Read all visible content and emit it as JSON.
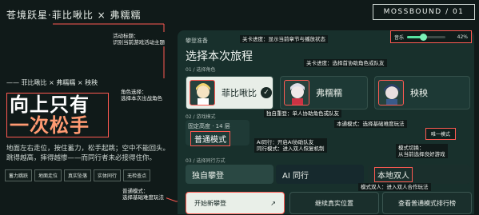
{
  "header": {
    "title": "苍境跃星·菲比啾比 × 弗糯糯",
    "brand": "MOSSBOUND / 01"
  },
  "left": {
    "divider": "—— 菲比啾比 × 弗糯糯 × 秧秧",
    "slogan_line1": "向上只有",
    "slogan_line2": "一次松手",
    "description": "地面左右走位，按住蓄力，松手起跳；空中不能回头。跳得越高，摔得越惨——而同行者未必接得住你。",
    "chips": [
      "蓄力跳跃",
      "地面走位",
      "真实坠落",
      "实体同行",
      "无检查点"
    ]
  },
  "music": {
    "label": "音乐",
    "value": "42%",
    "level": 0.42
  },
  "panel": {
    "kicker": "攀登准备",
    "title": "选择本次旅程",
    "section_character": "01 / 选择角色",
    "section_mode": "02 / 游戏模式",
    "section_play": "03 / 选择同行方式",
    "characters": [
      {
        "name": "菲比啾比",
        "selected": true
      },
      {
        "name": "弗糯糯",
        "selected": false
      },
      {
        "name": "秧秧",
        "selected": false
      }
    ],
    "difficulty_label": "固定高度 · 14 层",
    "difficulty_value": "普通模式",
    "mode_select_chip": "唯一模式",
    "play_modes": [
      "独自攀登",
      "AI 同行",
      "本地双人"
    ],
    "start_label": "开始新攀登",
    "start_icon": "↗",
    "continue_label": "继续真实位置",
    "leaderboard_label": "查看普通模式排行榜"
  },
  "annotations": {
    "activity_title": [
      "活动标题：",
      "识别当前游戏活动主题"
    ],
    "level_progress": "关卡进度：显示当前章节与播放状态",
    "level_select": "关卡进度：选择首协助角色或队友",
    "character_select": [
      "角色选择：",
      "选择本次出战角色"
    ],
    "solo_challenge": "独自重登：单人协助角色或队友",
    "normal_mode": "本通模式：选择基础难度玩法",
    "ai_companion": [
      "AI同行：开启AI协助队友",
      "同行模式：进入双人恢复机制"
    ],
    "mode_switch": [
      "模式切换：",
      "从当前选择良好游戏"
    ],
    "local_coop": "模式双人：进入双人合作玩法",
    "normal_mode_bottom": [
      "普通模式：",
      "选择基础难度玩法"
    ]
  },
  "colors": {
    "background": "#101a19",
    "panel": "#18302c",
    "accent_red": "#ff5a52",
    "slider_green": "#56e0a0"
  }
}
